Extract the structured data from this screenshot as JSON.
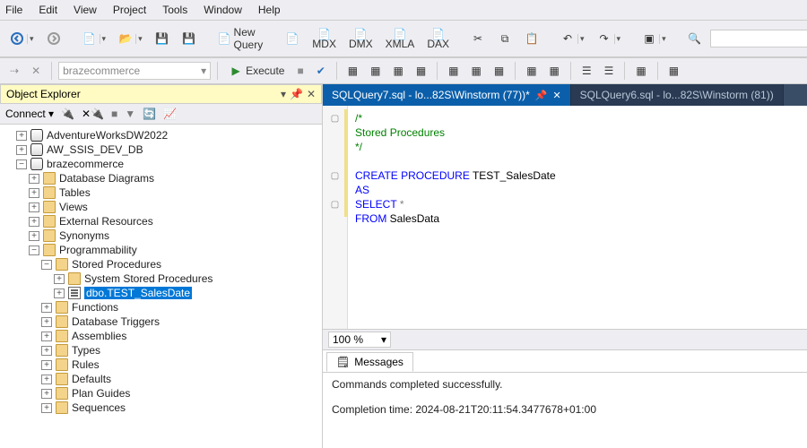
{
  "menu": {
    "file": "File",
    "edit": "Edit",
    "view": "View",
    "project": "Project",
    "tools": "Tools",
    "window": "Window",
    "help": "Help"
  },
  "toolbar1": {
    "new_query": "New Query",
    "mdx": "MDX",
    "dmx": "DMX",
    "xmla": "XMLA",
    "dax": "DAX",
    "search_placeholder": ""
  },
  "toolbar2": {
    "db_combo": "brazecommerce",
    "execute": "Execute"
  },
  "object_explorer": {
    "title": "Object Explorer",
    "connect": "Connect"
  },
  "tree": {
    "db1": "AdventureWorksDW2022",
    "db2": "AW_SSIS_DEV_DB",
    "db3": "brazecommerce",
    "diagrams": "Database Diagrams",
    "tables": "Tables",
    "views": "Views",
    "external": "External Resources",
    "synonyms": "Synonyms",
    "programmability": "Programmability",
    "sp": "Stored Procedures",
    "sys_sp": "System Stored Procedures",
    "test_proc": "dbo.TEST_SalesDate",
    "functions": "Functions",
    "triggers": "Database Triggers",
    "assemblies": "Assemblies",
    "types": "Types",
    "rules": "Rules",
    "defaults": "Defaults",
    "plan_guides": "Plan Guides",
    "sequences": "Sequences"
  },
  "tabs": {
    "active": "SQLQuery7.sql - lo...82S\\Winstorm (77))*",
    "inactive": "SQLQuery6.sql - lo...82S\\Winstorm (81))"
  },
  "code": {
    "l1": "/*",
    "l2": "Stored Procedures",
    "l3": "*/",
    "l4_a": "CREATE",
    "l4_b": "PROCEDURE",
    "l4_c": "TEST_SalesDate",
    "l5": "AS",
    "l6_a": "SELECT",
    "l6_b": "*",
    "l7_a": "FROM",
    "l7_b": "SalesData"
  },
  "zoom": "100 %",
  "messages": {
    "tab": "Messages",
    "line1": "Commands completed successfully.",
    "line2": "Completion time: 2024-08-21T20:11:54.3477678+01:00"
  }
}
